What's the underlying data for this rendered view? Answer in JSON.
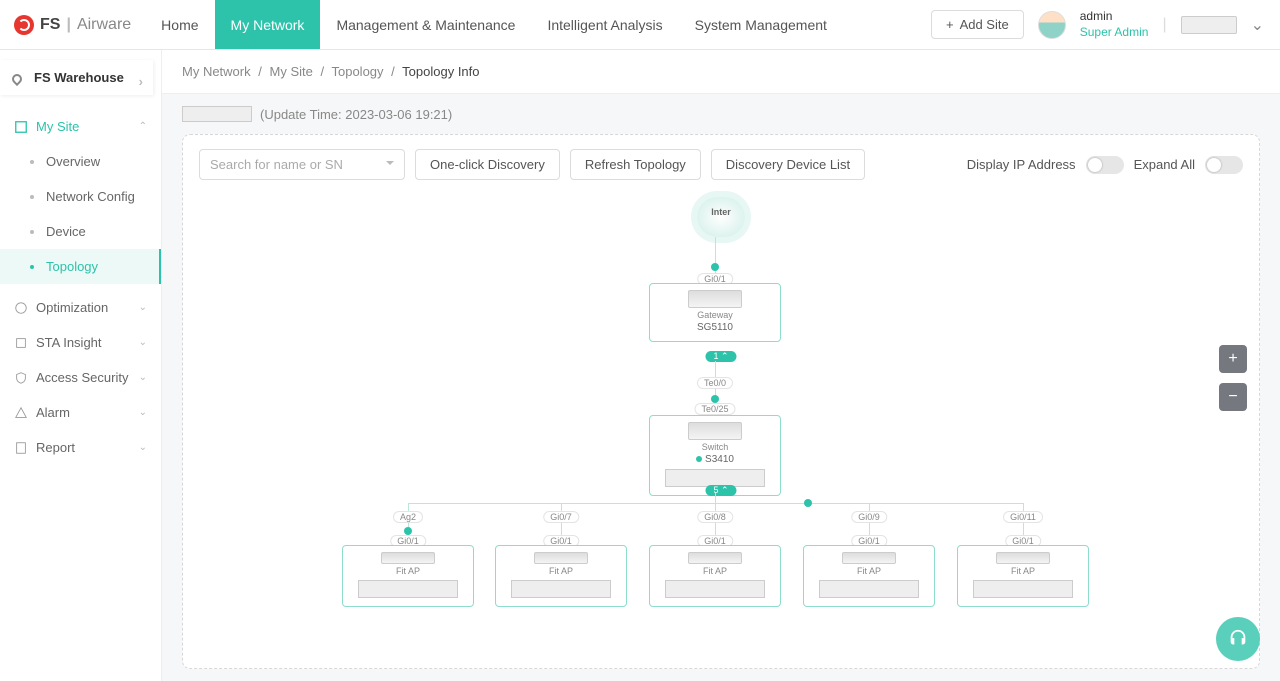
{
  "brand": {
    "fs": "FS",
    "airware": "Airware"
  },
  "nav": {
    "home": "Home",
    "my_network": "My Network",
    "mgmt": "Management & Maintenance",
    "analysis": "Intelligent Analysis",
    "system": "System Management"
  },
  "add_site": "Add Site",
  "user": {
    "name": "admin",
    "role": "Super Admin"
  },
  "site_selector": "FS Warehouse",
  "sidebar": {
    "my_site": "My Site",
    "subs": {
      "overview": "Overview",
      "network_config": "Network Config",
      "device": "Device",
      "topology": "Topology"
    },
    "optimization": "Optimization",
    "sta": "STA Insight",
    "access": "Access Security",
    "alarm": "Alarm",
    "report": "Report"
  },
  "crumbs": {
    "a": "My Network",
    "b": "My Site",
    "c": "Topology",
    "d": "Topology Info",
    "sep": "/"
  },
  "update_text": "(Update Time: 2023-03-06 19:21)",
  "toolbar": {
    "search_ph": "Search for name or SN",
    "discover": "One-click Discovery",
    "refresh": "Refresh Topology",
    "devlist": "Discovery Device List",
    "disp_ip": "Display IP Address",
    "expand_all": "Expand All"
  },
  "topo": {
    "inter": "Inter",
    "gateway": {
      "type": "Gateway",
      "model": "SG5110",
      "port_top": "Gi0/1",
      "badge": "1 ⌃"
    },
    "switch": {
      "type": "Switch",
      "model": "S3410",
      "port_top": "Te0/0",
      "port_bottom": "Te0/25",
      "badge": "5 ⌃"
    },
    "aps": [
      {
        "up": "Ag2",
        "down": "Gi0/1",
        "type": "Fit AP"
      },
      {
        "up": "Gi0/7",
        "down": "Gi0/1",
        "type": "Fit AP"
      },
      {
        "up": "Gi0/8",
        "down": "Gi0/1",
        "type": "Fit AP"
      },
      {
        "up": "Gi0/9",
        "down": "Gi0/1",
        "type": "Fit AP"
      },
      {
        "up": "Gi0/11",
        "down": "Gi0/1",
        "type": "Fit AP"
      }
    ]
  },
  "zoom": {
    "plus": "+",
    "minus": "−"
  }
}
